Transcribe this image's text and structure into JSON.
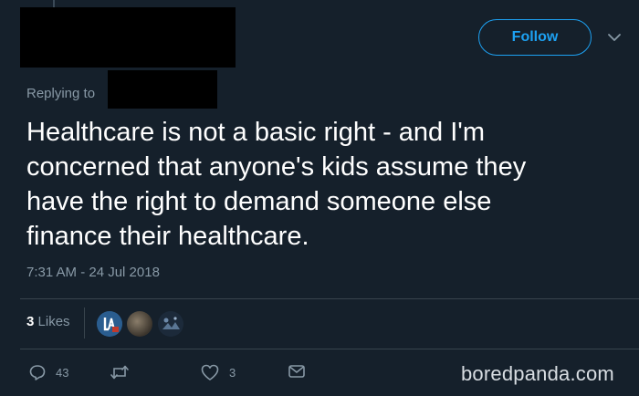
{
  "header": {
    "follow_label": "Follow",
    "caret_icon": "chevron-down-icon"
  },
  "reply": {
    "label": "Replying to"
  },
  "tweet": {
    "text": "Healthcare is not a basic right - and I'm\nconcerned that anyone's kids assume they\nhave the right to demand someone else\nfinance their healthcare.",
    "timestamp": "7:31 AM - 24 Jul 2018"
  },
  "likes": {
    "count": "3",
    "label": "Likes"
  },
  "actions": {
    "reply_count": "43",
    "retweet_count": "",
    "like_count": "3"
  },
  "watermark": "boredpanda.com",
  "colors": {
    "background": "#15202b",
    "accent": "#1da1f2",
    "muted": "#8899a6",
    "divider": "#38444d"
  }
}
